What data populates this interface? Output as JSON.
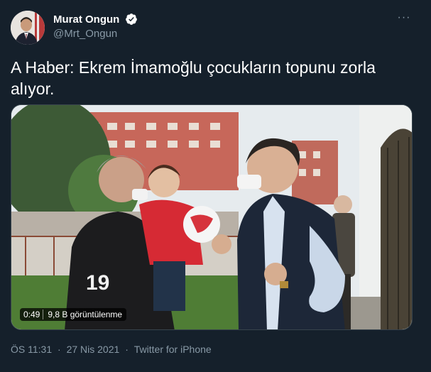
{
  "author": {
    "display_name": "Murat Ongun",
    "handle": "@Mrt_Ongun",
    "verified": true,
    "avatar_icon": "profile-photo"
  },
  "menu": {
    "more_icon": "more-horizontal-icon",
    "glyph": "···"
  },
  "tweet": {
    "text": "A Haber: Ekrem İmamoğlu çocukların topunu zorla alıyor."
  },
  "video": {
    "duration": "0:49",
    "views": "9,8 B görüntülenme"
  },
  "meta": {
    "time": "ÖS 11:31",
    "separator1": "·",
    "date": "27 Nis 2021",
    "separator2": "·",
    "source": "Twitter for iPhone"
  },
  "colors": {
    "background": "#15202b",
    "secondary_text": "#8899a6",
    "verified_badge": "#ffffff",
    "border": "#38444d"
  }
}
